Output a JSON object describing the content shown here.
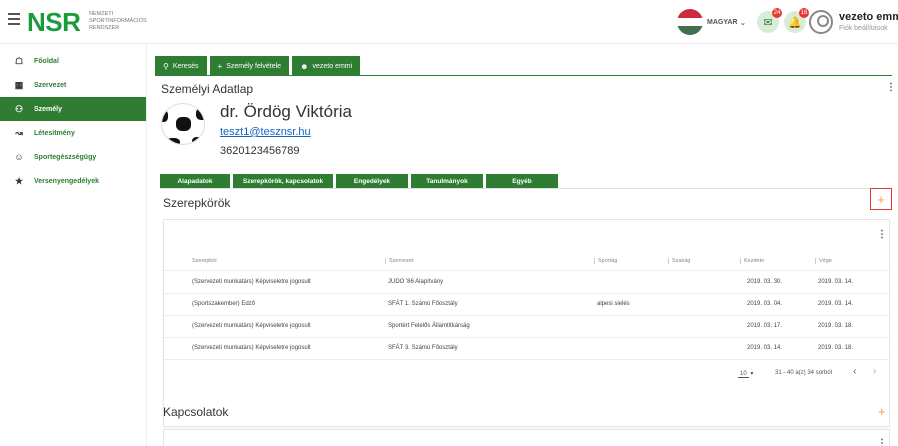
{
  "header": {
    "logo": "NSR",
    "logo_subtitle": "Nemzeti Sportinformációs Rendszer",
    "language": "MAGYAR",
    "notif_badge_1": "24",
    "notif_badge_2": "16",
    "user_name": "vezeto emmi",
    "user_subtitle": "Fiók beállítások"
  },
  "sidebar": {
    "items": [
      {
        "label": "Főoldal",
        "icon": "home-icon"
      },
      {
        "label": "Szervezet",
        "icon": "building-icon"
      },
      {
        "label": "Személy",
        "icon": "people-icon"
      },
      {
        "label": "Létesítmény",
        "icon": "facility-icon"
      },
      {
        "label": "Sportegészségügy",
        "icon": "health-icon"
      },
      {
        "label": "Versenyengedélyek",
        "icon": "star-icon"
      }
    ]
  },
  "tabs": {
    "search": "Keresés",
    "add_person": "Személy felvétele",
    "user": "vezeto emmi"
  },
  "person": {
    "section_title": "Személyi Adatlap",
    "name": "dr. Ördög Viktória",
    "email": "teszt1@tesznsr.hu",
    "phone": "3620123456789"
  },
  "sub_tabs": [
    "Alapadatok",
    "Szerepkörök, kapcsolatok",
    "Engedélyek",
    "Tanulmányok",
    "Egyéb"
  ],
  "roles": {
    "title": "Szerepkörök",
    "columns": [
      "Szerepkör",
      "Szervezet",
      "Sportág",
      "Szakág",
      "Kezdete",
      "Vége"
    ],
    "rows": [
      [
        "(Szervezeti munkatárs) Képviseletre jogosult",
        "JUDO '86 Alapítvány",
        "",
        "",
        "2019. 03. 30.",
        "2019. 03. 14."
      ],
      [
        "(Sportszakember) Edző",
        "SFÁT 1. Számú Főosztály",
        "alpesi sielés",
        "",
        "2019. 03. 04.",
        "2019. 03. 14."
      ],
      [
        "(Szervezeti munkatárs) Képviseletre jogosult",
        "Sportért Felelős Államtitkárság",
        "",
        "",
        "2019. 03. 17.",
        "2019. 03. 18."
      ],
      [
        "(Szervezeti munkatárs) Képviseletre jogosult",
        "SFÁT 3. Számú Főosztály",
        "",
        "",
        "2019. 03. 14.",
        "2019. 03. 18."
      ]
    ],
    "page_size": "10",
    "page_info": "31 - 40 a(z) 34 sorból"
  },
  "contacts": {
    "title": "Kapcsolatok"
  },
  "colors": {
    "primary": "#2e7d32",
    "accent": "#f4a142",
    "highlight": "#e53935"
  }
}
